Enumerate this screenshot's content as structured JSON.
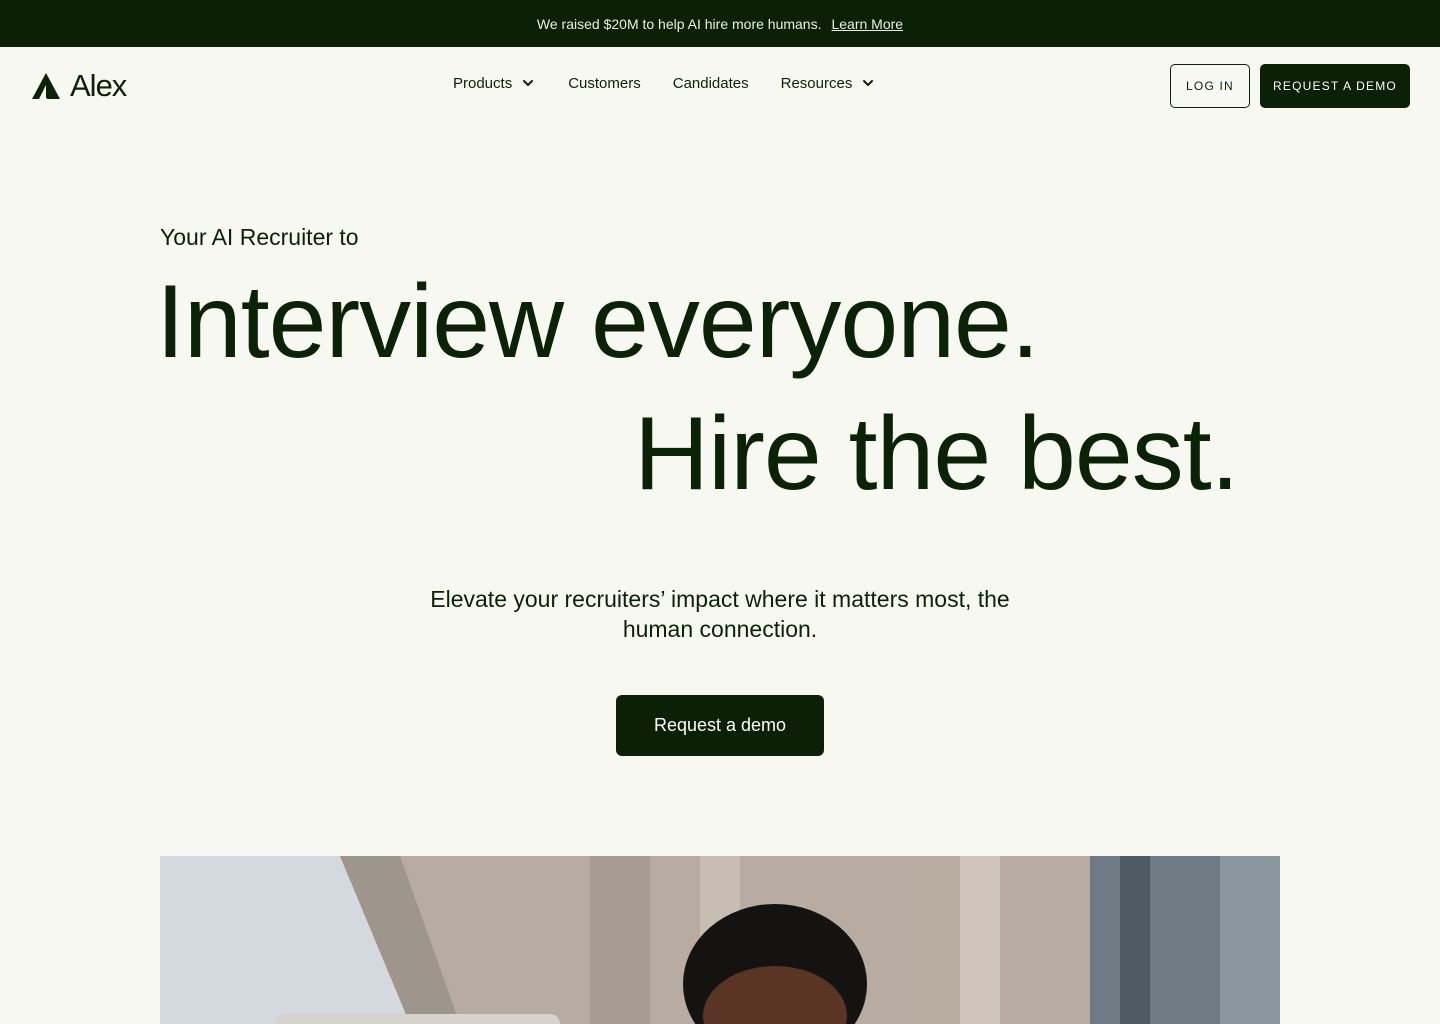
{
  "announcement": {
    "text": "We raised $20M to help AI hire more humans.",
    "link": "Learn More"
  },
  "brand": {
    "name": "Alex",
    "logo_icon": "alex-logo-mark"
  },
  "nav": {
    "items": [
      {
        "label": "Products",
        "has_dropdown": true
      },
      {
        "label": "Customers",
        "has_dropdown": false
      },
      {
        "label": "Candidates",
        "has_dropdown": false
      },
      {
        "label": "Resources",
        "has_dropdown": true
      }
    ],
    "login": "LOG IN",
    "request_demo": "REQUEST A DEMO"
  },
  "hero": {
    "eyebrow": "Your AI Recruiter to",
    "headline_1": "Interview everyone.",
    "headline_2": "Hire the best.",
    "subtext": "Elevate your recruiters’ impact where it matters most, the human connection.",
    "cta": "Request a demo"
  },
  "colors": {
    "background": "#f6f8f1",
    "dark_green": "#0c1f07",
    "text": "#0c2206"
  }
}
